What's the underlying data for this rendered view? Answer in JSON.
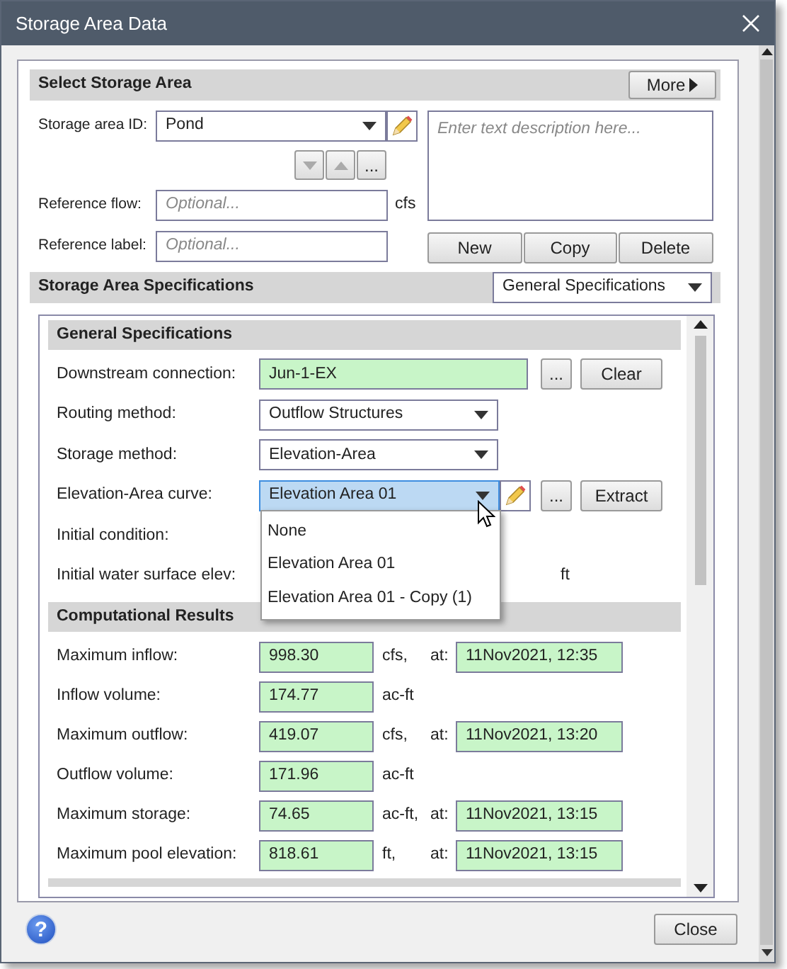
{
  "window": {
    "title": "Storage Area Data"
  },
  "select_section": {
    "title": "Select Storage Area",
    "more_button": "More",
    "storage_area_id": {
      "label": "Storage area ID:",
      "value": "Pond"
    },
    "nav_buttons": [
      {
        "kind": "down",
        "disabled": true
      },
      {
        "kind": "up",
        "disabled": true
      },
      {
        "kind": "browse",
        "label": "...",
        "disabled": false
      }
    ],
    "description": {
      "placeholder": "Enter text description here..."
    },
    "reference_flow": {
      "label": "Reference flow:",
      "placeholder": "Optional...",
      "unit": "cfs"
    },
    "reference_label": {
      "label": "Reference label:",
      "placeholder": "Optional..."
    },
    "buttons": [
      "New",
      "Copy",
      "Delete"
    ]
  },
  "specs_section": {
    "title": "Storage Area Specifications",
    "view": "General Specifications"
  },
  "general": {
    "title": "General Specifications",
    "rows": [
      {
        "kind": "picker",
        "label": "Downstream connection:",
        "value": "Jun-1-EX",
        "buttons": [
          "...",
          "Clear"
        ]
      },
      {
        "kind": "dropdown",
        "label": "Routing method:",
        "value": "Outflow Structures"
      },
      {
        "kind": "dropdown",
        "label": "Storage method:",
        "value": "Elevation-Area"
      },
      {
        "kind": "open_dropdown",
        "label": "Elevation-Area curve:",
        "value": "Elevation Area 01",
        "buttons": [
          "...",
          "Extract"
        ],
        "options": [
          "None",
          "Elevation Area 01",
          "Elevation Area 01 - Copy (1)"
        ]
      },
      {
        "kind": "blank",
        "label": "Initial condition:"
      },
      {
        "kind": "blank",
        "label": "Initial water surface elev:",
        "unit": "ft"
      }
    ]
  },
  "results": {
    "title": "Computational Results",
    "rows": [
      {
        "label": "Maximum inflow:",
        "value": "998.30",
        "unit": "cfs,",
        "at": "at:",
        "time": "11Nov2021, 12:35"
      },
      {
        "label": "Inflow volume:",
        "value": "174.77",
        "unit": "ac-ft"
      },
      {
        "label": "Maximum outflow:",
        "value": "419.07",
        "unit": "cfs,",
        "at": "at:",
        "time": "11Nov2021, 13:20"
      },
      {
        "label": "Outflow volume:",
        "value": "171.96",
        "unit": "ac-ft"
      },
      {
        "label": "Maximum storage:",
        "value": "74.65",
        "unit": "ac-ft,",
        "at": "at:",
        "time": "11Nov2021, 13:15"
      },
      {
        "label": "Maximum pool elevation:",
        "value": "818.61",
        "unit": "ft,",
        "at": "at:",
        "time": "11Nov2021, 13:15"
      }
    ]
  },
  "footer": {
    "help_button": "?",
    "close_button": "Close"
  }
}
